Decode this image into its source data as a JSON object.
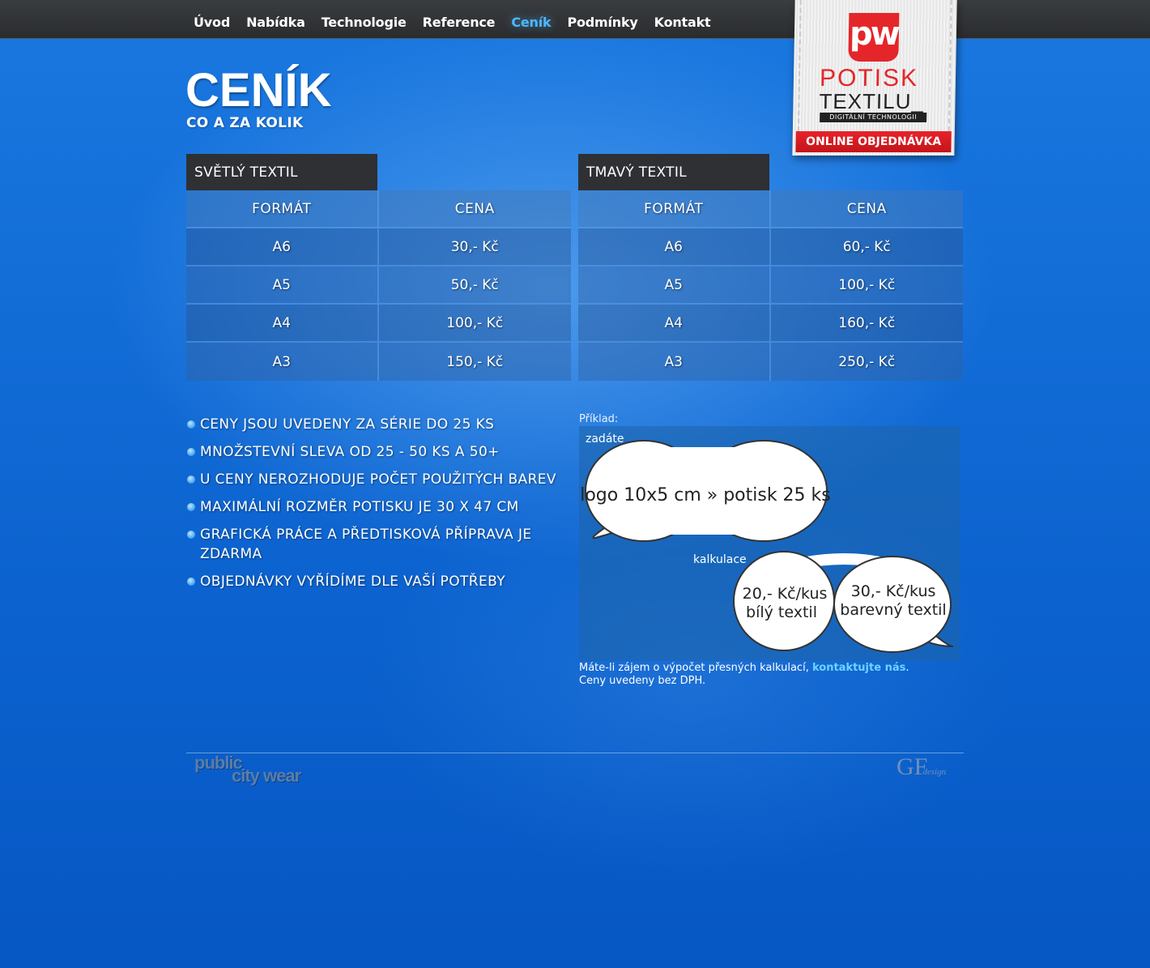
{
  "nav": {
    "items": [
      {
        "label": "Úvod"
      },
      {
        "label": "Nabídka"
      },
      {
        "label": "Technologie"
      },
      {
        "label": "Reference"
      },
      {
        "label": "Ceník",
        "active": true
      },
      {
        "label": "Podmínky"
      },
      {
        "label": "Kontakt"
      }
    ]
  },
  "logo": {
    "mark": "pw",
    "line1": "POTISK",
    "line2": "TEXTILU_",
    "tagline": "DIGITÁLNÍ TECHNOLOGII",
    "cta": "ONLINE OBJEDNÁVKA"
  },
  "heading": {
    "title": "CENÍK",
    "subtitle": "CO A ZA KOLIK"
  },
  "tables": [
    {
      "title": "SVĚTLÝ TEXTIL",
      "headers": [
        "FORMÁT",
        "CENA"
      ],
      "rows": [
        [
          "A6",
          "30,- Kč"
        ],
        [
          "A5",
          "50,- Kč"
        ],
        [
          "A4",
          "100,- Kč"
        ],
        [
          "A3",
          "150,- Kč"
        ]
      ]
    },
    {
      "title": "TMAVÝ TEXTIL",
      "headers": [
        "FORMÁT",
        "CENA"
      ],
      "rows": [
        [
          "A6",
          "60,- Kč"
        ],
        [
          "A5",
          "100,- Kč"
        ],
        [
          "A4",
          "160,- Kč"
        ],
        [
          "A3",
          "250,- Kč"
        ]
      ]
    }
  ],
  "notes": [
    "CENY JSOU UVEDENY ZA SÉRIE DO 25 KS",
    "MNOŽSTEVNÍ SLEVA OD 25 - 50 KS A 50+",
    "U CENY NEROZHODUJE POČET POUŽITÝCH BAREV",
    "MAXIMÁLNÍ ROZMĚR POTISKU JE 30 X 47 CM",
    "GRAFICKÁ PRÁCE A PŘEDTISKOVÁ PŘÍPRAVA JE ZDARMA",
    "OBJEDNÁVKY VYŘÍDÍME DLE VAŠÍ POTŘEBY"
  ],
  "example": {
    "label": "Příklad:",
    "zadate": "zadáte",
    "input_bubble": "logo 10x5 cm » potisk 25 ks",
    "kalkulace": "kalkulace",
    "bubble_white_1": "20,- Kč/kus",
    "bubble_white_2": "bílý textil",
    "bubble_color_1": "30,- Kč/kus",
    "bubble_color_2": "barevný textil",
    "info_prefix": "Máte-li zájem o výpočet přesných kalkulací, ",
    "info_link": "kontaktujte nás",
    "info_suffix": ".",
    "info_line2": "Ceny uvedeny bez DPH."
  },
  "footer": {
    "brand_top": "public",
    "brand_bottom": "city wear",
    "designer": "GF",
    "designer_sub": "design"
  }
}
